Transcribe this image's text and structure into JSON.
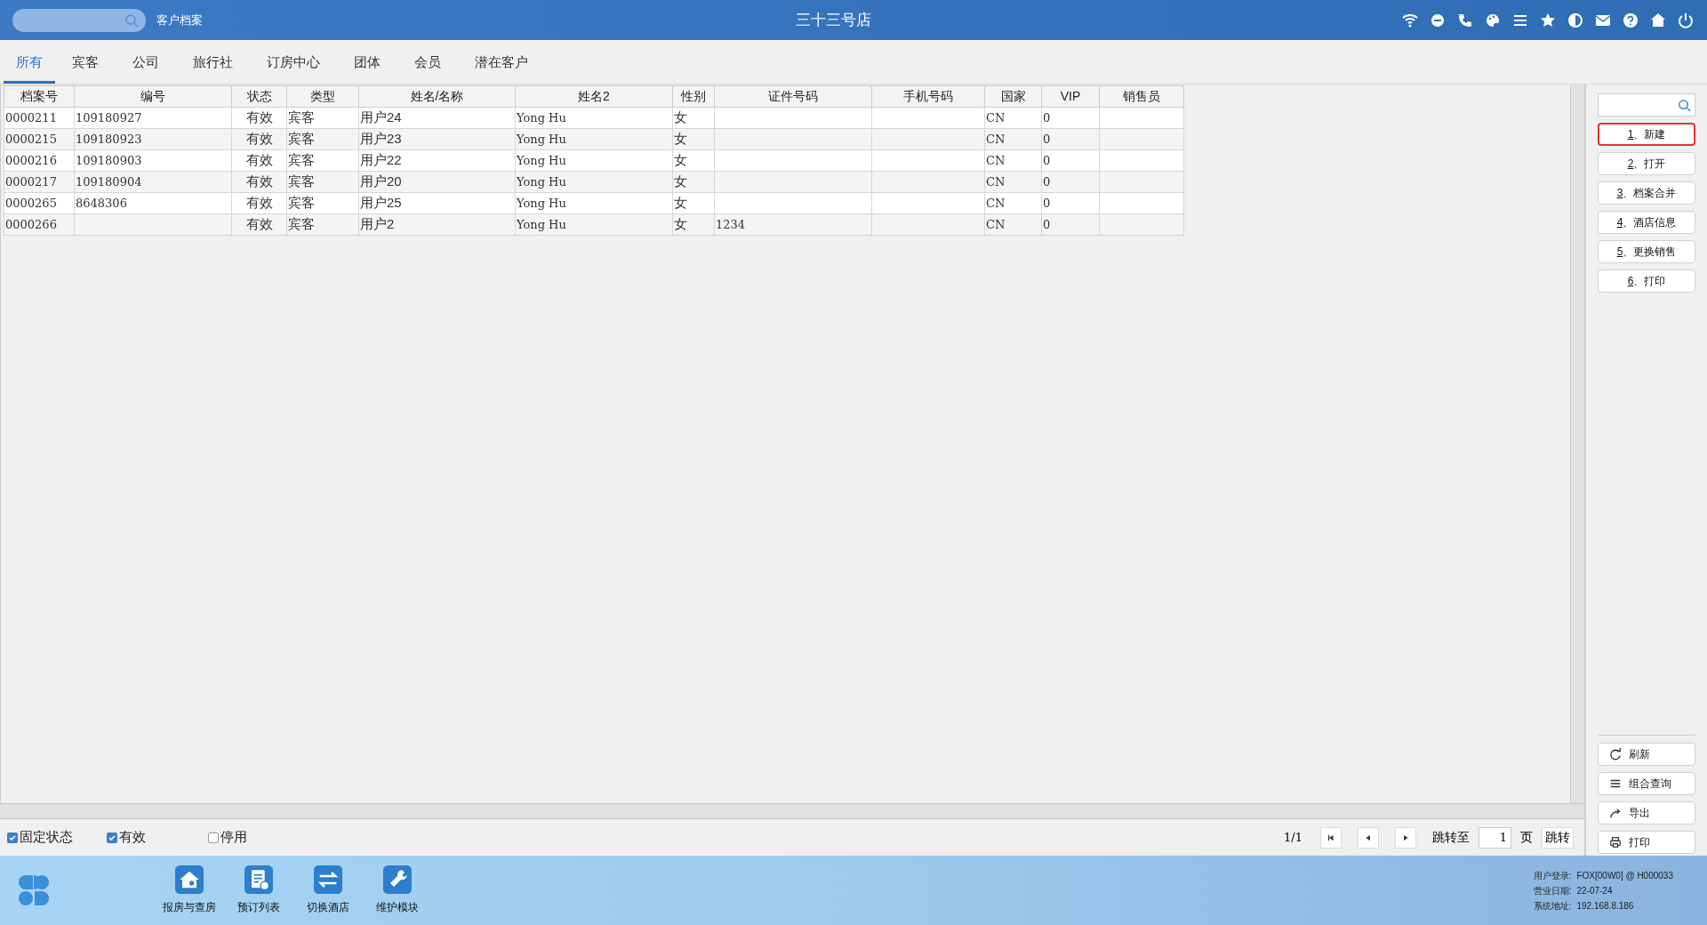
{
  "header": {
    "module": "客户档案",
    "title": "三十三号店"
  },
  "tabs": [
    {
      "label": "所有",
      "selected": true
    },
    {
      "label": "宾客",
      "selected": false
    },
    {
      "label": "公司",
      "selected": false
    },
    {
      "label": "旅行社",
      "selected": false
    },
    {
      "label": "订房中心",
      "selected": false
    },
    {
      "label": "团体",
      "selected": false
    },
    {
      "label": "会员",
      "selected": false
    },
    {
      "label": "潜在客户",
      "selected": false
    }
  ],
  "table": {
    "columns": [
      "档案号",
      "编号",
      "状态",
      "类型",
      "姓名/名称",
      "姓名2",
      "性别",
      "证件号码",
      "手机号码",
      "国家",
      "VIP",
      "销售员"
    ],
    "rows": [
      [
        "0000211",
        "109180927",
        "有效",
        "宾客",
        "用户24",
        "Yong Hu",
        "女",
        "",
        "",
        "CN",
        "0",
        ""
      ],
      [
        "0000215",
        "109180923",
        "有效",
        "宾客",
        "用户23",
        "Yong Hu",
        "女",
        "",
        "",
        "CN",
        "0",
        ""
      ],
      [
        "0000216",
        "109180903",
        "有效",
        "宾客",
        "用户22",
        "Yong Hu",
        "女",
        "",
        "",
        "CN",
        "0",
        ""
      ],
      [
        "0000217",
        "109180904",
        "有效",
        "宾客",
        "用户20",
        "Yong Hu",
        "女",
        "",
        "",
        "CN",
        "0",
        ""
      ],
      [
        "0000265",
        "8648306",
        "有效",
        "宾客",
        "用户25",
        "Yong Hu",
        "女",
        "",
        "",
        "CN",
        "0",
        ""
      ],
      [
        "0000266",
        "",
        "有效",
        "宾客",
        "用户2",
        "Yong Hu",
        "女",
        "1234",
        "",
        "CN",
        "0",
        ""
      ]
    ]
  },
  "filters": [
    {
      "label": "固定状态",
      "checked": true
    },
    {
      "label": "有效",
      "checked": true
    },
    {
      "label": "停用",
      "checked": false
    }
  ],
  "pagination": {
    "page": "1/1",
    "goto_label": "跳转至",
    "page_value": "1",
    "page_unit": "页",
    "go": "跳转"
  },
  "actions": [
    {
      "label": "1、新建",
      "selected": true
    },
    {
      "label": "2、打开",
      "selected": false
    },
    {
      "label": "3、档案合并",
      "selected": false
    },
    {
      "label": "4、酒店信息",
      "selected": false
    },
    {
      "label": "5、更换销售",
      "selected": false
    },
    {
      "label": "6、打印",
      "selected": false
    }
  ],
  "tools": [
    {
      "kind": "refresh",
      "label": "刷新"
    },
    {
      "kind": "query",
      "label": "组合查询"
    },
    {
      "kind": "export",
      "label": "导出"
    },
    {
      "kind": "print",
      "label": "打印"
    }
  ],
  "taskbar": [
    {
      "kind": "house",
      "label": "报房与查房"
    },
    {
      "kind": "list",
      "label": "预订列表"
    },
    {
      "kind": "switch",
      "label": "切换酒店"
    },
    {
      "kind": "wrench",
      "label": "维护模块"
    }
  ],
  "status": [
    {
      "label": "用户登录:",
      "value": "FOX[00W0] @ H000033"
    },
    {
      "label": "营业日期:",
      "value": "22-07-24"
    },
    {
      "label": "系统地址:",
      "value": "192.168.8.186"
    }
  ]
}
